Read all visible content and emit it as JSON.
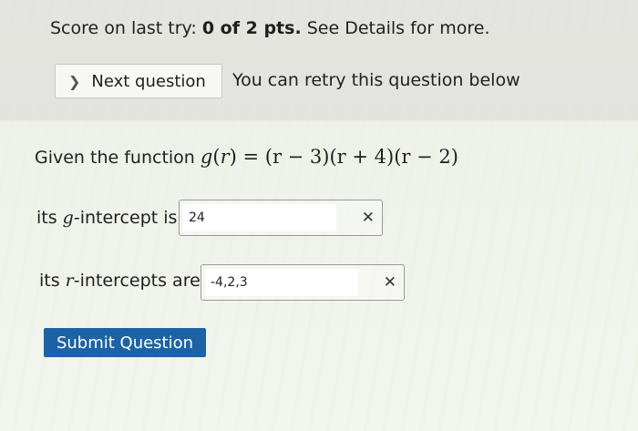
{
  "score": {
    "prefix": "Score on last try: ",
    "value": "0 of 2 pts.",
    "suffix": " See Details for more."
  },
  "next_question": {
    "icon": "chevron-right-icon",
    "label": "Next question"
  },
  "retry_message": "You can retry this question below",
  "question": {
    "prompt": "Given the function ",
    "function_name": "g",
    "variable": "r",
    "expression_rhs": " = (r − 3)(r + 4)(r − 2)"
  },
  "g_intercept": {
    "label_prefix": "its ",
    "label_var": "g",
    "label_suffix": "-intercept is",
    "value": "24",
    "status_mark": "✕"
  },
  "r_intercepts": {
    "label_prefix": "its ",
    "label_var": "r",
    "label_suffix": "-intercepts are",
    "value": "-4,2,3",
    "status_mark": "✕"
  },
  "submit": {
    "label": "Submit Question",
    "color": "#1b63a6"
  }
}
